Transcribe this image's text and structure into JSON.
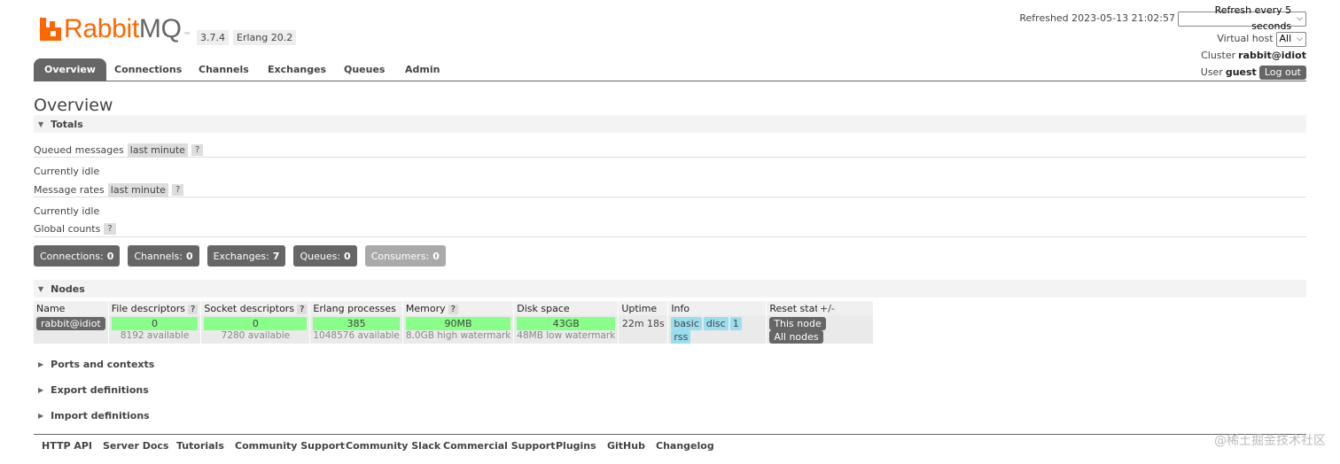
{
  "header": {
    "logo_word_1": "Rabbit",
    "logo_word_2": "MQ",
    "logo_dot": "™",
    "version": "3.7.4",
    "erlang": "Erlang 20.2",
    "refreshed": "Refreshed 2023-05-13 21:02:57",
    "refresh_select": "Refresh every 5 seconds",
    "virtual_host_label": "Virtual host",
    "virtual_host_value": "All",
    "cluster_label": "Cluster",
    "cluster_value": "rabbit@idiot",
    "user_label": "User",
    "user_value": "guest",
    "logout": "Log out"
  },
  "tabs": [
    {
      "label": "Overview",
      "active": true
    },
    {
      "label": "Connections"
    },
    {
      "label": "Channels"
    },
    {
      "label": "Exchanges"
    },
    {
      "label": "Queues"
    },
    {
      "label": "Admin"
    }
  ],
  "page_title": "Overview",
  "totals": {
    "heading": "Totals",
    "queued_messages_label": "Queued messages",
    "queued_range": "last minute",
    "help": "?",
    "queued_idle": "Currently idle",
    "message_rates_label": "Message rates",
    "rates_range": "last minute",
    "rates_idle": "Currently idle",
    "global_counts_label": "Global counts",
    "counts": [
      {
        "label": "Connections:",
        "value": "0"
      },
      {
        "label": "Channels:",
        "value": "0"
      },
      {
        "label": "Exchanges:",
        "value": "7"
      },
      {
        "label": "Queues:",
        "value": "0"
      },
      {
        "label": "Consumers:",
        "value": "0"
      }
    ]
  },
  "nodes": {
    "heading": "Nodes",
    "columns": [
      "Name",
      "File descriptors",
      "Socket descriptors",
      "Erlang processes",
      "Memory",
      "Disk space",
      "Uptime",
      "Info",
      "Reset stats"
    ],
    "help": "?",
    "row": {
      "name": "rabbit@idiot",
      "file_descriptors": "0",
      "file_available": "8192 available",
      "socket_descriptors": "0",
      "socket_available": "7280 available",
      "erlang_processes": "385",
      "erlang_available": "1048576 available",
      "memory": "90MB",
      "memory_watermark": "8.0GB high watermark",
      "disk_space": "43GB",
      "disk_watermark": "48MB low watermark",
      "uptime": "22m 18s",
      "info": [
        "basic",
        "disc",
        "1",
        "rss"
      ],
      "reset_this": "This node",
      "reset_all": "All nodes"
    },
    "plus_minus": "+/-"
  },
  "sections": {
    "ports": "Ports and contexts",
    "export": "Export definitions",
    "import": "Import definitions"
  },
  "footer": [
    "HTTP API",
    "Server Docs",
    "Tutorials",
    "Community Support",
    "Community Slack",
    "Commercial Support",
    "Plugins",
    "GitHub",
    "Changelog"
  ],
  "watermark": "@稀土掘金技术社区",
  "colors": {
    "brand": "#ff6600",
    "tab_active": "#666666",
    "ok_green": "#88ff88",
    "info_blue": "#99ddee"
  }
}
